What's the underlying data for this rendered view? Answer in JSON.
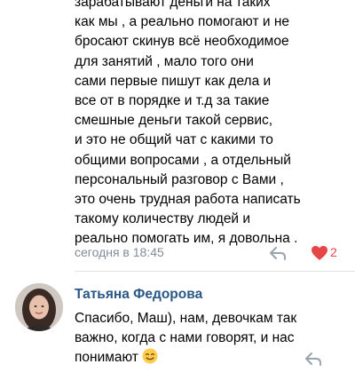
{
  "comment1": {
    "lines": [
      "зарабатывают деньги на таких",
      "как мы , а реально помогают и не",
      "бросают скинув всё необходимое",
      "для занятий , мало того они",
      "сами первые пишут как дела и",
      "все от в порядке и т.д за такие",
      "смешные деньги такой сервис,",
      "и это не общий чат с какими то",
      "общими вопросами , а отдельный",
      "персональный разговор с Вами ,",
      "это очень трудная работа написать",
      "такому количеству людей и",
      "реально помогать им, я довольна ."
    ],
    "time": "сегодня в 18:45",
    "likes": "2",
    "reply_icon": "reply-arrow-icon",
    "like_icon": "heart-icon",
    "like_color": "#e64646"
  },
  "comment2": {
    "author": "Татьяна Федорова",
    "author_color": "#2a5885",
    "lines": [
      "Спасибо, Маш), нам, девочкам так",
      "важно, когда с нами говорят, и нас",
      "понимают"
    ],
    "emoji_icon": "smiling-face-icon",
    "reply_icon": "reply-arrow-icon"
  },
  "colors": {
    "meta_text": "#818c99",
    "divider": "#e1e3e6"
  }
}
